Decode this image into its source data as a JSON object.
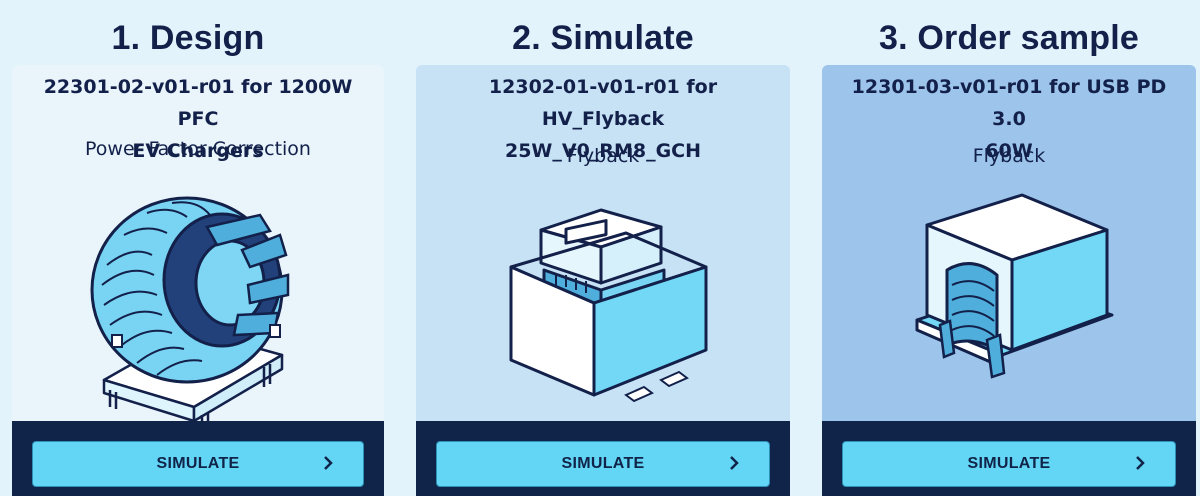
{
  "steps": [
    {
      "title": "1. Design"
    },
    {
      "title": "2. Simulate"
    },
    {
      "title": "3. Order sample"
    }
  ],
  "cards": [
    {
      "title_line1": "22301-02-v01-r01 for 1200W PFC",
      "title_line2": "EV Chargers",
      "subtitle": "Power Factor Correction",
      "button": "SIMULATE",
      "illustration": "toroidal-inductor",
      "bg": "#e9f4fb"
    },
    {
      "title_line1": "12302-01-v01-r01 for HV_Flyback",
      "title_line2": "25W_V0_RM8_GCH",
      "subtitle": "Flyback",
      "button": "SIMULATE",
      "illustration": "flyback-transformer",
      "bg": "#c8e2f5"
    },
    {
      "title_line1": "12301-03-v01-r01 for USB PD 3.0",
      "title_line2": "60W",
      "subtitle": "Flyback",
      "button": "SIMULATE",
      "illustration": "rm-core-transformer",
      "bg": "#9dc4ea"
    }
  ],
  "colors": {
    "accent": "#63d5f5",
    "navy": "#102348"
  },
  "icons": {
    "button_chevron": "chevron-right-icon"
  }
}
